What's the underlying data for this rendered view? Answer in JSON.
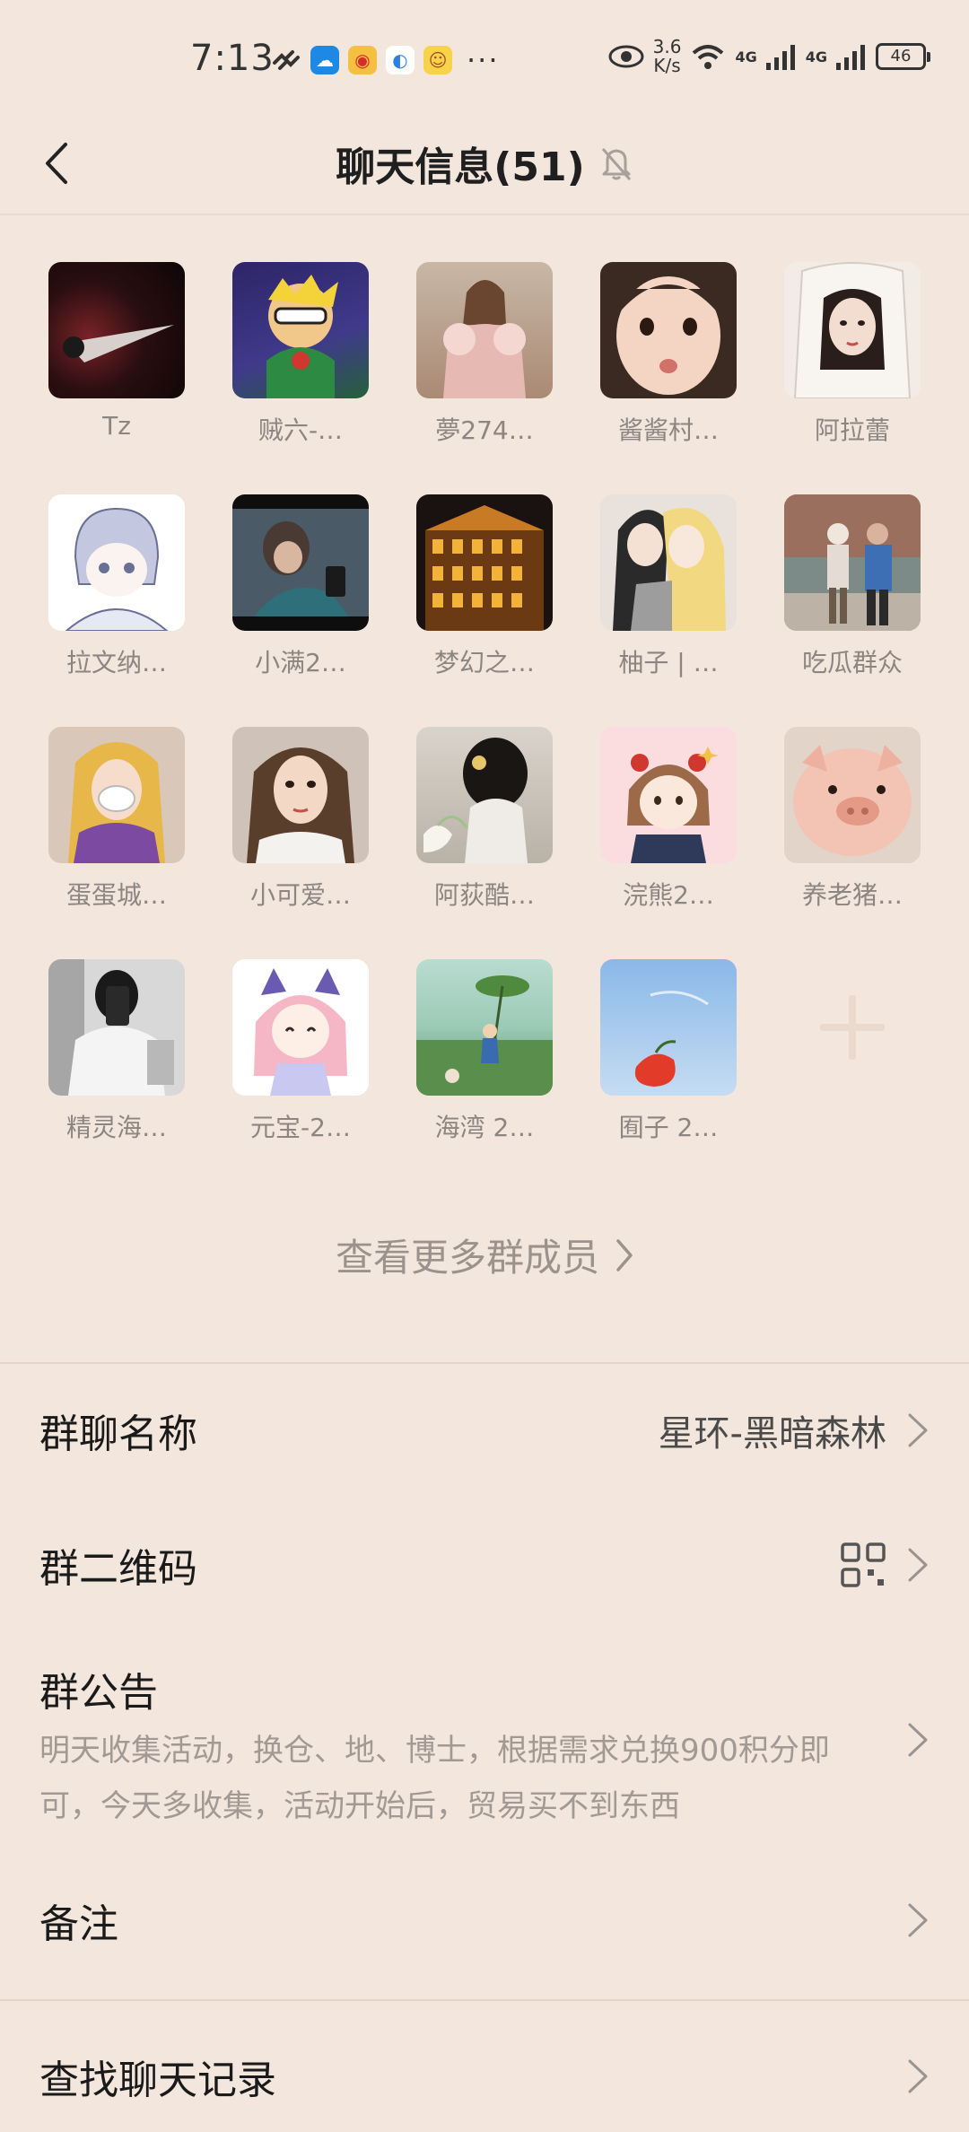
{
  "status_bar": {
    "time": "7:13",
    "speed_value": "3.6",
    "speed_unit": "K/s",
    "signal1_label": "4G",
    "signal2_label": "4G",
    "battery": "46",
    "overflow": "···"
  },
  "header": {
    "title": "聊天信息(51)"
  },
  "members": [
    {
      "name": "Tz",
      "avatar": "dark-avatar-icon"
    },
    {
      "name": "贼六-…",
      "avatar": "cartoon-avatar-icon"
    },
    {
      "name": "夢274…",
      "avatar": "portrait-avatar-icon"
    },
    {
      "name": "酱酱村…",
      "avatar": "child-avatar-icon"
    },
    {
      "name": "阿拉蕾",
      "avatar": "drawing-avatar-icon"
    },
    {
      "name": "拉文纳…",
      "avatar": "sketch-avatar-icon"
    },
    {
      "name": "小满2…",
      "avatar": "photo-avatar-icon"
    },
    {
      "name": "梦幻之…",
      "avatar": "building-avatar-icon"
    },
    {
      "name": "柚子 | …",
      "avatar": "anime-avatar-icon"
    },
    {
      "name": "吃瓜群众",
      "avatar": "street-avatar-icon"
    },
    {
      "name": "蛋蛋城…",
      "avatar": "princess-avatar-icon"
    },
    {
      "name": "小可爱…",
      "avatar": "girl-avatar-icon"
    },
    {
      "name": "阿荻酷…",
      "avatar": "hair-avatar-icon"
    },
    {
      "name": "浣熊2…",
      "avatar": "chibi-avatar-icon"
    },
    {
      "name": "养老猪…",
      "avatar": "pig-avatar-icon"
    },
    {
      "name": "精灵海…",
      "avatar": "mirror-avatar-icon"
    },
    {
      "name": "元宝-2…",
      "avatar": "anime-girl-avatar-icon"
    },
    {
      "name": "海湾 2…",
      "avatar": "field-avatar-icon"
    },
    {
      "name": "囿子 2…",
      "avatar": "sky-avatar-icon"
    }
  ],
  "more_members_label": "查看更多群成员",
  "group_name": {
    "label": "群聊名称",
    "value": "星环-黑暗森林"
  },
  "qr_code": {
    "label": "群二维码"
  },
  "notice": {
    "label": "群公告",
    "body": "明天收集活动，换仓、地、博士，根据需求兑换900积分即可，今天多收集，活动开始后，贸易买不到东西"
  },
  "remark": {
    "label": "备注"
  },
  "search_history": {
    "label": "查找聊天记录"
  },
  "colors": {
    "background": "#f3e6dc",
    "muted_text": "#8d8580"
  }
}
